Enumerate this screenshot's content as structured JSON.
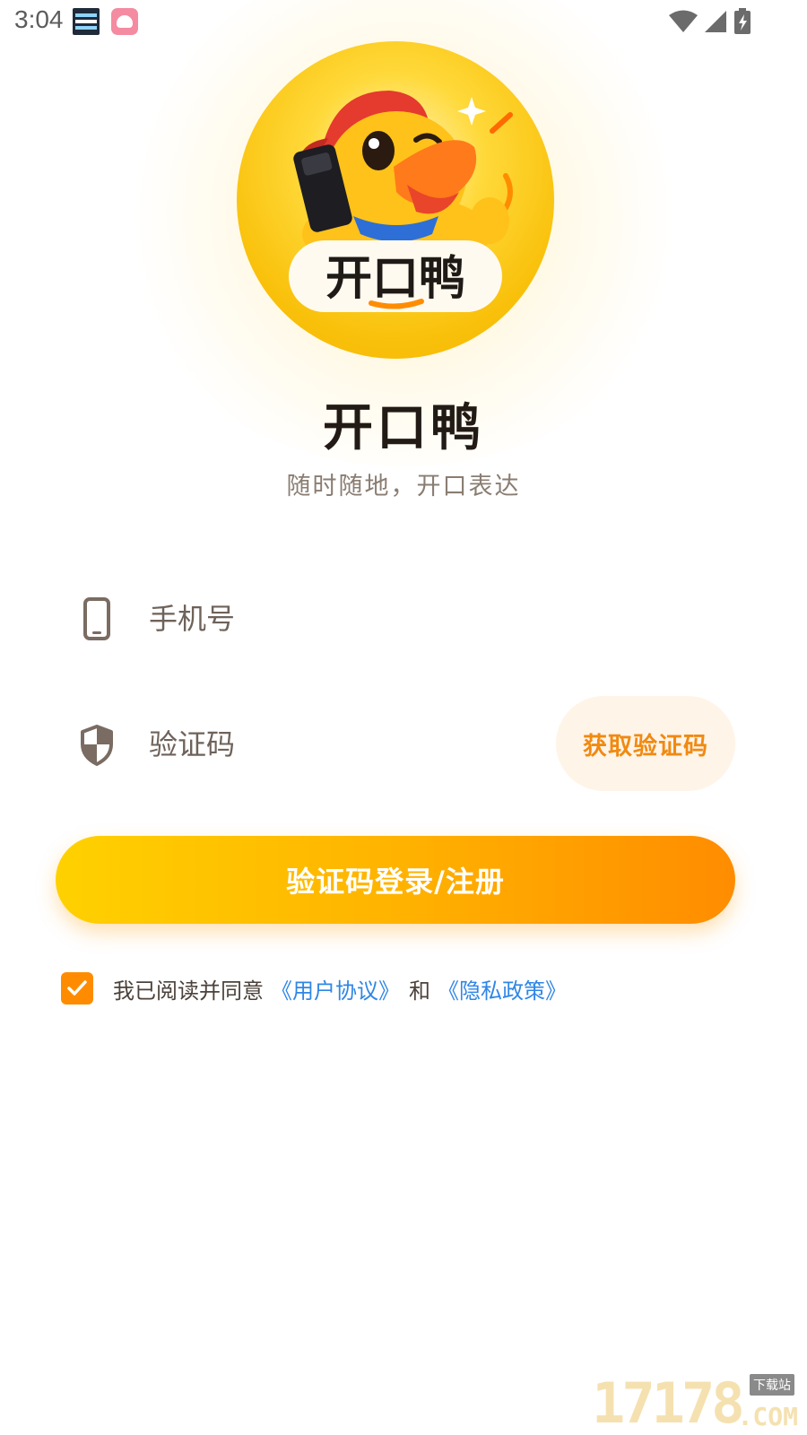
{
  "status_bar": {
    "time": "3:04",
    "icons": [
      "dashboard-notification-icon",
      "app-notification-icon",
      "wifi-icon",
      "cellular-signal-icon",
      "battery-charging-icon"
    ]
  },
  "app": {
    "logo_text": "开口鸭",
    "title": "开口鸭",
    "slogan": "随时随地，开口表达",
    "brand_color": "#f9c10b",
    "accent_color": "#ff8c00",
    "link_color": "#2f86e6"
  },
  "form": {
    "phone": {
      "placeholder": "手机号",
      "value": "",
      "icon": "phone-icon"
    },
    "code": {
      "placeholder": "验证码",
      "value": "",
      "icon": "shield-icon"
    },
    "get_code_label": "获取验证码",
    "login_label": "验证码登录/注册"
  },
  "agreement": {
    "checked": true,
    "prefix": "我已阅读并同意",
    "user_agreement": "《用户协议》",
    "and": "和",
    "privacy_policy": "《隐私政策》"
  },
  "watermark": {
    "number": "17178",
    "tag": "下载站",
    "domain": ".COM"
  }
}
